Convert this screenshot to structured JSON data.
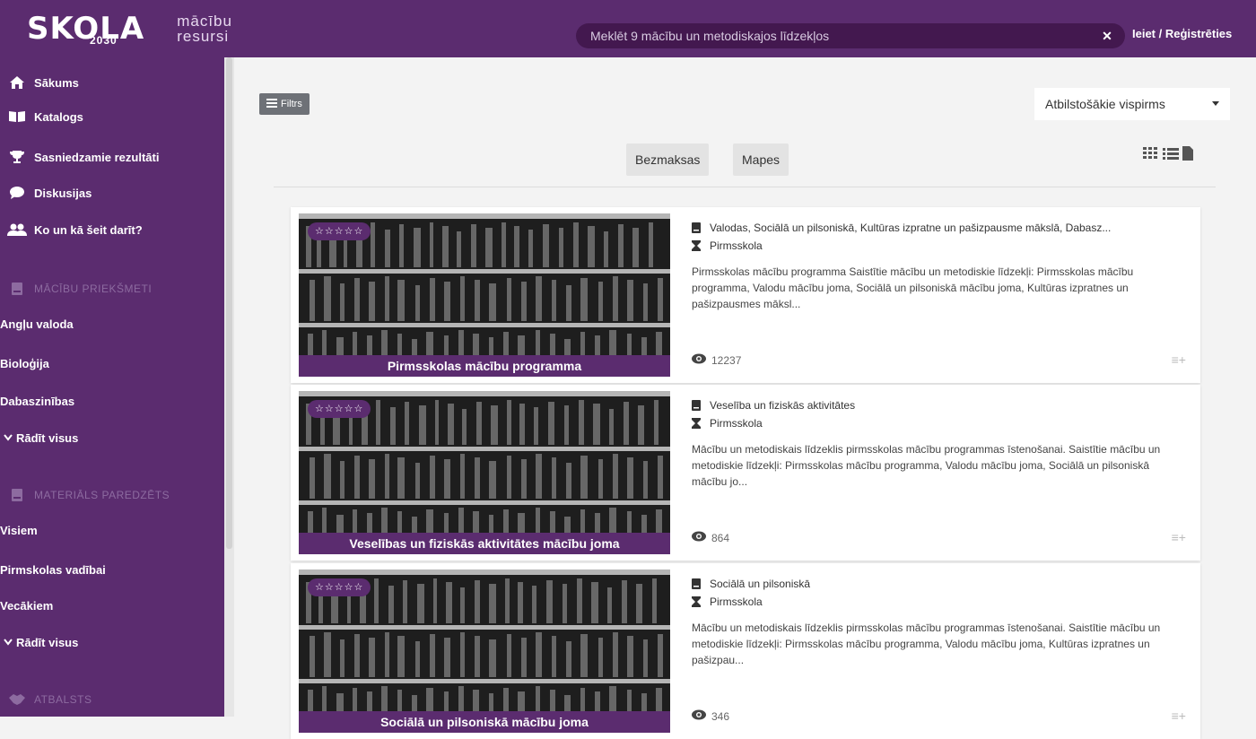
{
  "header": {
    "logo_mark": "SKOLA",
    "logo_year": "2030",
    "logo_line1": "mācību",
    "logo_line2": "resursi",
    "search_placeholder": "Meklēt 9 mācību un metodiskajos līdzekļos",
    "login_label": "Ieiet / Reģistrēties"
  },
  "sidebar": {
    "nav": [
      {
        "label": "Sākums",
        "icon": "home-icon"
      },
      {
        "label": "Katalogs",
        "icon": "book-icon"
      },
      {
        "label": "Sasniedzamie rezultāti",
        "icon": "trophy-icon"
      },
      {
        "label": "Diskusijas",
        "icon": "chat-icon"
      },
      {
        "label": "Ko un kā šeit darīt?",
        "icon": "users-icon"
      }
    ],
    "subjects_heading": "MĀCĪBU PRIEKŠMETI",
    "subjects": [
      "Angļu valoda",
      "Bioloģija",
      "Dabaszinības"
    ],
    "subjects_more": "Rādīt visus",
    "audience_heading": "MATERIĀLS PAREDZĒTS",
    "audience": [
      "Visiem",
      "Pirmskolas vadībai",
      "Vecākiem"
    ],
    "audience_more": "Rādīt visus",
    "support_heading": "ATBALSTS"
  },
  "toolbar": {
    "filter_label": "Filtrs",
    "sort_selected": "Atbilstošākie vispirms",
    "chip_free": "Bezmaksas",
    "chip_folders": "Mapes"
  },
  "results": [
    {
      "title": "Pirmsskolas mācību programma",
      "subjects": "Valodas, Sociālā un pilsoniskā, Kultūras izpratne un pašizpausme mākslā, Dabasz...",
      "level": "Pirmsskola",
      "description": "Pirmsskolas mācību programma Saistītie mācību un metodiskie līdzekļi: Pirmsskolas mācību programma, Valodu mācību joma, Sociālā un pilsoniskā mācību joma, Kultūras izpratnes un pašizpausmes māksl...",
      "views": "12237"
    },
    {
      "title": "Veselības un fiziskās aktivitātes mācību joma",
      "subjects": "Veselība un fiziskās aktivitātes",
      "level": "Pirmsskola",
      "description": "Mācību un metodiskais līdzeklis pirmsskolas mācību programmas īstenošanai. Saistītie mācību un metodiskie līdzekļi: Pirmsskolas mācību programma, Valodu mācību joma, Sociālā un pilsoniskā mācību jo...",
      "views": "864"
    },
    {
      "title": "Sociālā un pilsoniskā mācību joma",
      "subjects": "Sociālā un pilsoniskā",
      "level": "Pirmsskola",
      "description": "Mācību un metodiskais līdzeklis pirmsskolas mācību programmas īstenošanai. Saistītie mācību un metodiskie līdzekļi: Pirmsskolas mācību programma, Valodu mācību joma, Kultūras izpratnes un pašizpau...",
      "views": "346"
    }
  ],
  "colors": {
    "brand": "#5b2c6f",
    "search_bg": "#43184f"
  }
}
